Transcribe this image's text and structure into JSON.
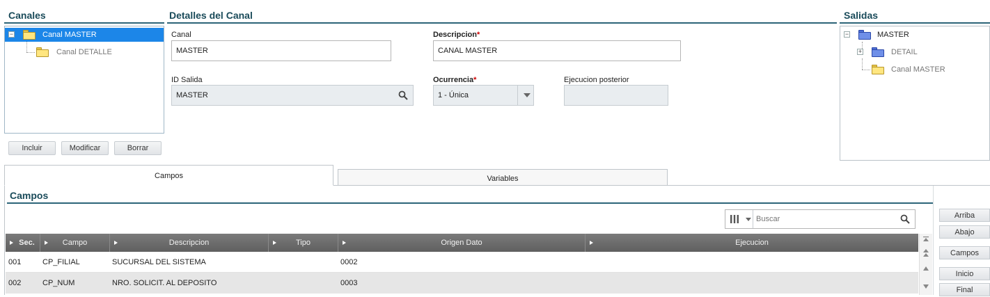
{
  "canales": {
    "title": "Canales",
    "tree": [
      {
        "label": "Canal MASTER",
        "selected": true,
        "expander": "−"
      },
      {
        "label": "Canal DETALLE",
        "selected": false
      }
    ],
    "buttons": {
      "incluir": "Incluir",
      "modificar": "Modificar",
      "borrar": "Borrar"
    }
  },
  "detalles": {
    "title": "Detalles del Canal",
    "canal": {
      "label": "Canal",
      "value": "MASTER"
    },
    "descripcion": {
      "label": "Descripcion",
      "required": "*",
      "value": "CANAL MASTER"
    },
    "id_salida": {
      "label": "ID Salida",
      "value": "MASTER"
    },
    "ocurrencia": {
      "label": "Ocurrencia",
      "required": "*",
      "value": "1 - Única"
    },
    "ejecucion": {
      "label": "Ejecucion posterior",
      "value": ""
    }
  },
  "salidas": {
    "title": "Salidas",
    "tree": [
      {
        "label": "MASTER",
        "expander": "−"
      },
      {
        "label": "DETAIL",
        "expander": "+"
      },
      {
        "label": "Canal MASTER"
      }
    ]
  },
  "tabs": [
    {
      "label": "Campos",
      "active": true
    },
    {
      "label": "Variables",
      "active": false
    }
  ],
  "campos": {
    "title": "Campos",
    "search_placeholder": "Buscar",
    "columns": [
      "Sec.",
      "Campo",
      "Descripcion",
      "Tipo",
      "Origen Dato",
      "Ejecucion"
    ],
    "rows": [
      {
        "sec": "001",
        "campo": "CP_FILIAL",
        "descripcion": "SUCURSAL DEL SISTEMA",
        "tipo": "",
        "origen": "0002",
        "ejecucion": ""
      },
      {
        "sec": "002",
        "campo": "CP_NUM",
        "descripcion": "NRO. SOLICIT. AL DEPOSITO",
        "tipo": "",
        "origen": "0003",
        "ejecucion": ""
      }
    ],
    "side_buttons": {
      "arriba": "Arriba",
      "abajo": "Abajo",
      "campos": "Campos",
      "inicio": "Inicio",
      "final": "Final"
    }
  },
  "colors": {
    "accent": "#1a4b5a",
    "selection": "#1c86e8",
    "required": "#cc0000"
  }
}
